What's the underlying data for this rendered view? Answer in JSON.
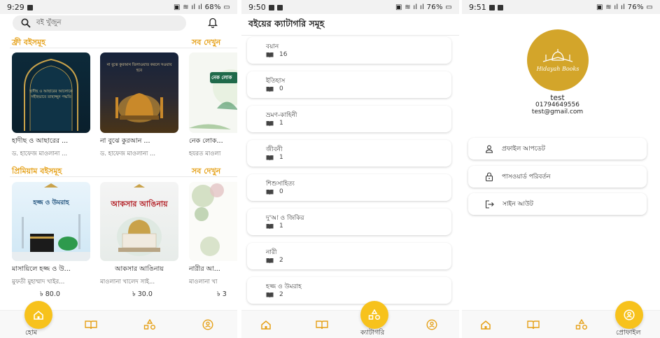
{
  "panel1": {
    "status": {
      "time": "9:29",
      "battery": "68%"
    },
    "search": {
      "placeholder": "বই খুঁজুন"
    },
    "free_section": {
      "title": "ফ্রী বইসমূহ",
      "see_all": "সব দেখুন"
    },
    "free_books": [
      {
        "title": "হাদীছ ও আছারের ...",
        "author": "ড. হাফেজ মাওলানা ...",
        "cover_text": "হাদীছ ও আছারের আলোকে সহীহভাবে তাহাজ্জুদ পদ্ধতি"
      },
      {
        "title": "না বুঝে কুরআন ...",
        "author": "ড. হাফেজ মাওলানা ...",
        "cover_text": "না বুঝে কুরআন তিলাওয়াত করলে সওয়াব হবে"
      },
      {
        "title": "নেক লোক...",
        "author": "হযরত মাওলা",
        "cover_text": "নেক লোক"
      }
    ],
    "premium_section": {
      "title": "প্রিমিয়াম বইসমূহ",
      "see_all": "সব দেখুন"
    },
    "premium_books": [
      {
        "title": "মাসায়িলে হজ্জ ও উ...",
        "author": "মুফতী মুহাম্মাদ খাইর...",
        "price": "৳ 80.0",
        "cover_text": "হজ্জ ও উমরাহ"
      },
      {
        "title": "আকসার আঙিনায়",
        "author": "মাওলানা খালেদ সাই...",
        "price": "৳ 30.0",
        "cover_text": "আকসার আঙিনায়"
      },
      {
        "title": "নারীর আ...",
        "author": "মাওলানা খা",
        "price": "৳ 3"
      }
    ],
    "nav": {
      "home_label": "হোম"
    }
  },
  "panel2": {
    "status": {
      "time": "9:50",
      "battery": "76%"
    },
    "title": "বইয়ের ক্যাটাগরি সমূহ",
    "categories": [
      {
        "name": "বয়ান",
        "count": "16"
      },
      {
        "name": "ইতিহাস",
        "count": "0"
      },
      {
        "name": "ভ্রমণ-কাহিনী",
        "count": "1"
      },
      {
        "name": "জীবনী",
        "count": "1"
      },
      {
        "name": "শিশুসাহিত্য",
        "count": "0"
      },
      {
        "name": "দু'আ ও জিকির",
        "count": "1"
      },
      {
        "name": "নারী",
        "count": "2"
      },
      {
        "name": "হজ্জ ও উমরাহ",
        "count": "2"
      }
    ],
    "nav": {
      "category_label": "ক্যাটাগরি"
    }
  },
  "panel3": {
    "status": {
      "time": "9:51",
      "battery": "76%"
    },
    "logo_text": "Hidayah Books",
    "user": {
      "name": "test",
      "phone": "01794649556",
      "email": "test@gmail.com"
    },
    "options": [
      {
        "label": "প্রফাইল আপডেট",
        "icon": "person-icon"
      },
      {
        "label": "পাসওয়ার্ড পরিবর্তন",
        "icon": "lock-icon"
      },
      {
        "label": "সাইন আউট",
        "icon": "logout-icon"
      }
    ],
    "nav": {
      "profile_label": "প্রোফাইল"
    }
  },
  "colors": {
    "accent": "#f7c21c",
    "section": "#e5a017",
    "logo": "#d3a52a"
  }
}
